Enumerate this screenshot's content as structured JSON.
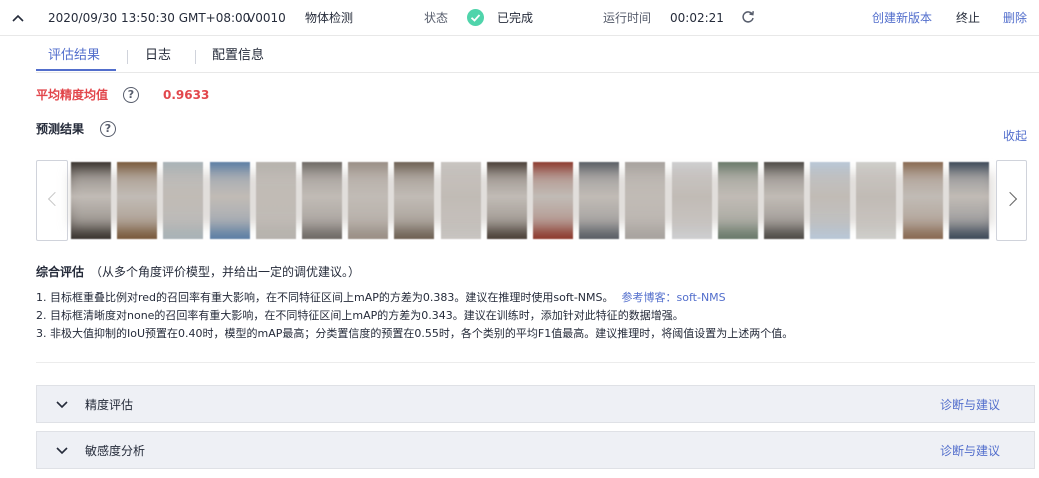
{
  "header": {
    "date": "2020/09/30 13:50:30 GMT+08:00",
    "version": "V0010",
    "task_type": "物体检测",
    "status_label": "状态",
    "status": "已完成",
    "runtime_label": "运行时间",
    "runtime": "00:02:21",
    "actions": {
      "create": "创建新版本",
      "stop": "终止",
      "delete": "删除"
    }
  },
  "tabs": [
    {
      "label": "评估结果",
      "active": true
    },
    {
      "label": "日志",
      "active": false
    },
    {
      "label": "配置信息",
      "active": false
    }
  ],
  "metric": {
    "label": "平均精度均值",
    "value": "0.9633",
    "help": "?"
  },
  "prediction": {
    "label": "预测结果",
    "help": "?",
    "collapse": "收起",
    "thumbnail_colors": [
      "#3a342f",
      "#7a5a3c",
      "#a9b3b8",
      "#5d7fa6",
      "#b7b3ae",
      "#6f6a66",
      "#9a8f86",
      "#6e6154",
      "#c9c5c2",
      "#4b4038",
      "#8e3a2e",
      "#5a5f66",
      "#a8a39f",
      "#cfcfd1",
      "#6a7a6b",
      "#4e4a46",
      "#b9c8d8",
      "#d0cfcc",
      "#8a6a52",
      "#3e4a5a"
    ]
  },
  "evaluation": {
    "title": "综合评估",
    "subtitle": "（从多个角度评价模型，并给出一定的调优建议。）",
    "lines": [
      "1. 目标框重叠比例对red的召回率有重大影响，在不同特征区间上mAP的方差为0.383。建议在推理时使用soft-NMS。",
      "2. 目标框清晰度对none的召回率有重大影响，在不同特征区间上mAP的方差为0.343。建议在训练时，添加针对此特征的数据增强。",
      "3. 非极大值抑制的IoU预置在0.40时，模型的mAP最高；分类置信度的预置在0.55时，各个类别的平均F1值最高。建议推理时，将阈值设置为上述两个值。"
    ],
    "ref_link": "参考博客：soft-NMS"
  },
  "panels": [
    {
      "title": "精度评估",
      "link": "诊断与建议"
    },
    {
      "title": "敏感度分析",
      "link": "诊断与建议"
    }
  ],
  "colors": {
    "accent": "#526ecc",
    "danger": "#e2474c",
    "success": "#50d4ab"
  }
}
